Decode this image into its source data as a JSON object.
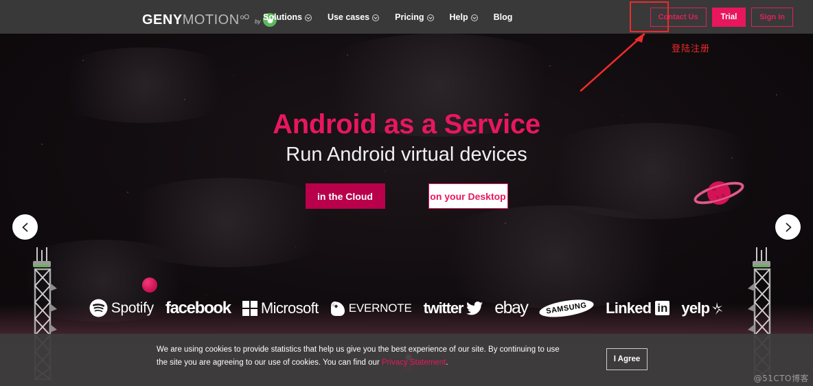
{
  "header": {
    "logo": {
      "primary": "GENY",
      "secondary": "MOTION",
      "superscript": "oO",
      "by": "by",
      "mascot_icon": "genymobile-mascot-icon"
    },
    "nav": [
      {
        "label": "Solutions",
        "has_dropdown": true
      },
      {
        "label": "Use cases",
        "has_dropdown": true
      },
      {
        "label": "Pricing",
        "has_dropdown": true
      },
      {
        "label": "Help",
        "has_dropdown": true
      },
      {
        "label": "Blog",
        "has_dropdown": false
      }
    ],
    "actions": {
      "contact": "Contact Us",
      "trial": "Trial",
      "signin": "Sign In"
    }
  },
  "annotation": {
    "text": "登陆注册",
    "color": "#ee2b2b",
    "arrow_icon": "annotation-arrow-icon",
    "highlight_target": "Sign In"
  },
  "hero": {
    "title": "Android as a Service",
    "subtitle": "Run Android virtual devices",
    "cta_primary": "in the Cloud",
    "cta_secondary": "on your Desktop",
    "prev_icon": "chevron-left-icon",
    "next_icon": "chevron-right-icon",
    "decor": {
      "planet_icon": "ringed-planet-icon",
      "moon_icon": "moon-icon",
      "rocket_icon": "rocket-icon",
      "tower_icon": "antenna-tower-icon"
    }
  },
  "logos": [
    {
      "name": "Spotify",
      "label": "Spotify",
      "icon": "spotify-icon"
    },
    {
      "name": "facebook",
      "label": "facebook",
      "icon": "facebook-wordmark-icon"
    },
    {
      "name": "Microsoft",
      "label": "Microsoft",
      "icon": "microsoft-squares-icon"
    },
    {
      "name": "EVERNOTE",
      "label": "EVERNOTE",
      "icon": "evernote-elephant-icon"
    },
    {
      "name": "twitter",
      "label": "twitter",
      "icon": "twitter-bird-icon"
    },
    {
      "name": "ebay",
      "label": "ebay",
      "icon": "ebay-wordmark-icon"
    },
    {
      "name": "SAMSUNG",
      "label": "SAMSUNG",
      "icon": "samsung-oval-icon"
    },
    {
      "name": "LinkedIn",
      "label": "Linked",
      "badge": "in",
      "icon": "linkedin-icon"
    },
    {
      "name": "yelp",
      "label": "yelp",
      "icon": "yelp-burst-icon"
    }
  ],
  "cookie": {
    "text_before": "We are using cookies to provide statistics that help us give you the best experience of our site. By continuing to use the site you are agreeing to our use of cookies. You can find our ",
    "link": "Privacy Statement",
    "text_after": ".",
    "agree": "I Agree"
  },
  "watermark": "@51CTO博客",
  "colors": {
    "accent_pink": "#e8175d",
    "accent_crimson": "#b8004b",
    "header_bg": "#393939",
    "annotation_red": "#ee2b2b",
    "mascot_green": "#5cb85c"
  }
}
